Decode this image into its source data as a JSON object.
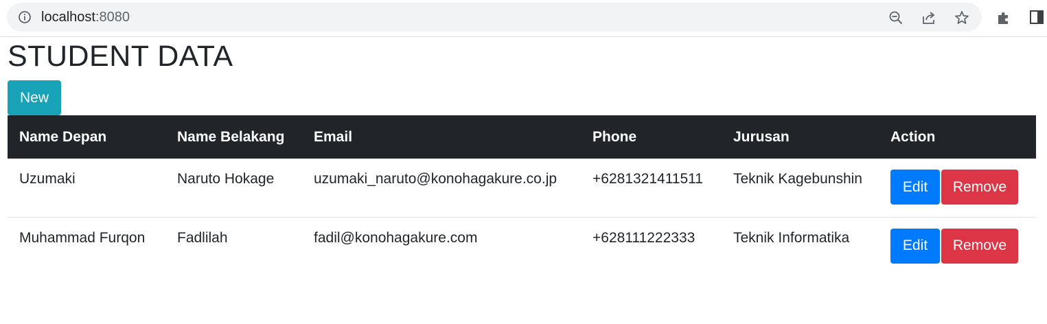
{
  "browser": {
    "url_host": "localhost",
    "url_port": ":8080"
  },
  "page": {
    "title": "STUDENT DATA",
    "new_button": "New"
  },
  "table": {
    "headers": [
      "Name Depan",
      "Name Belakang",
      "Email",
      "Phone",
      "Jurusan",
      "Action"
    ],
    "rows": [
      {
        "first_name": "Uzumaki",
        "last_name": "Naruto Hokage",
        "email": "uzumaki_naruto@konohagakure.co.jp",
        "phone": "+6281321411511",
        "major": "Teknik Kagebunshin"
      },
      {
        "first_name": "Muhammad Furqon",
        "last_name": "Fadlilah",
        "email": "fadil@konohagakure.com",
        "phone": "+628111222333",
        "major": "Teknik Informatika"
      }
    ],
    "edit_label": "Edit",
    "remove_label": "Remove"
  },
  "colors": {
    "header_bg": "#212529",
    "new_button": "#17a2b8",
    "edit_button": "#007bff",
    "remove_button": "#dc3545"
  }
}
